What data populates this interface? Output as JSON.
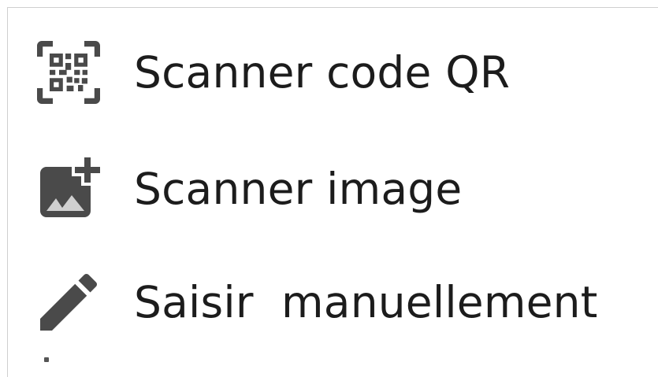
{
  "menu": {
    "items": [
      {
        "label": "Scanner code QR",
        "icon": "qr-code-scanner-icon"
      },
      {
        "label": "Scanner image",
        "icon": "add-photo-icon"
      },
      {
        "label": "Saisir  manuellement",
        "icon": "pencil-icon"
      }
    ]
  },
  "colors": {
    "text": "#1c1c1c",
    "icon": "#4a4a4a",
    "background": "#ffffff",
    "border": "#cfcfcf"
  }
}
